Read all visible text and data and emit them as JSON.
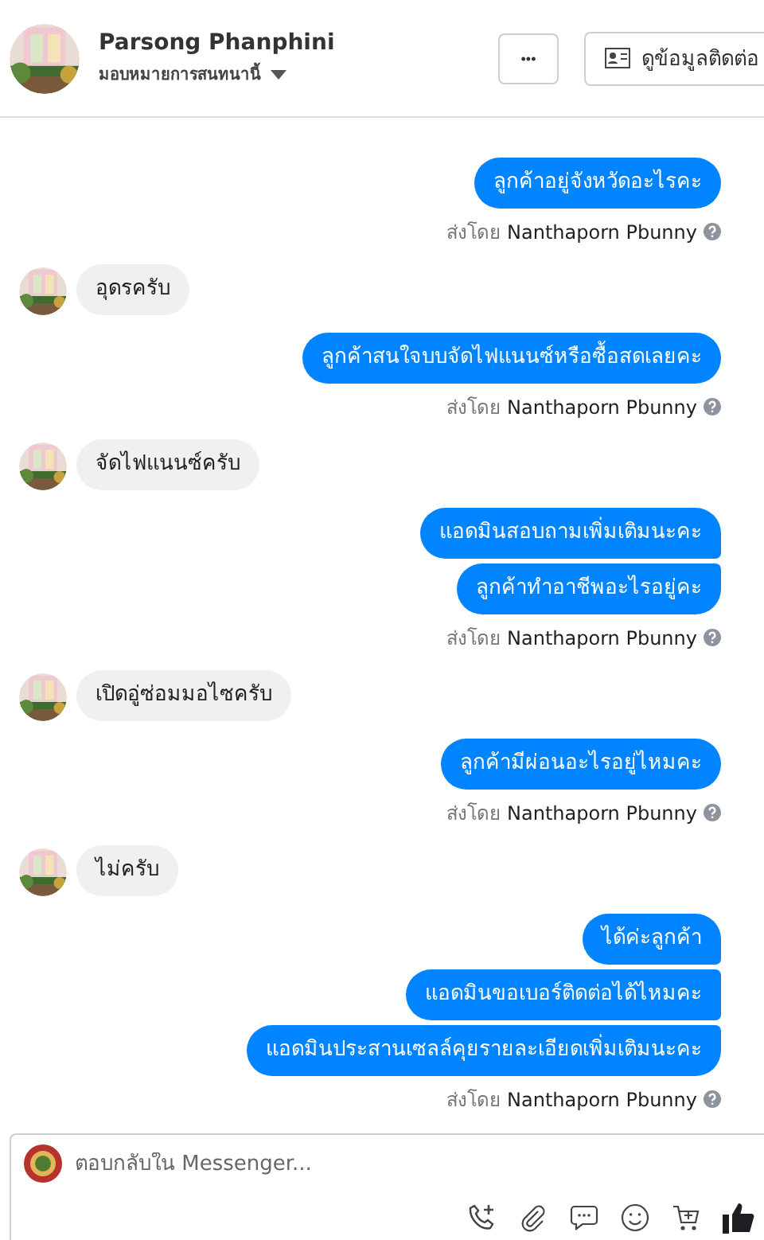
{
  "header": {
    "name": "Parsong Phanphini",
    "subtitle": "มอบหมายการสนทนานี้",
    "more_button": "•••",
    "contact_button": "ดูข้อมูลติดต่อ"
  },
  "messages": [
    {
      "kind": "outgoing",
      "bubbles": [
        "ลูกค้าอยู่จังหวัดอะไรคะ"
      ],
      "sent_prefix": "ส่งโดย",
      "sent_by": "Nanthaporn Pbunny"
    },
    {
      "kind": "incoming",
      "bubbles": [
        "อุดรครับ"
      ]
    },
    {
      "kind": "outgoing",
      "bubbles": [
        "ลูกค้าสนใจบบจัดไฟแนนซ์หรือซื้อสดเลยคะ"
      ],
      "sent_prefix": "ส่งโดย",
      "sent_by": "Nanthaporn Pbunny"
    },
    {
      "kind": "incoming",
      "bubbles": [
        "จัดไฟแนนซ์ครับ"
      ]
    },
    {
      "kind": "outgoing",
      "bubbles": [
        "แอดมินสอบถามเพิ่มเติมนะคะ",
        "ลูกค้าทำอาชีพอะไรอยู่คะ"
      ],
      "sent_prefix": "ส่งโดย",
      "sent_by": "Nanthaporn Pbunny"
    },
    {
      "kind": "incoming",
      "bubbles": [
        "เปิดอู่ซ่อมมอไซครับ"
      ]
    },
    {
      "kind": "outgoing",
      "bubbles": [
        "ลูกค้ามีผ่อนอะไรอยู่ไหมคะ"
      ],
      "sent_prefix": "ส่งโดย",
      "sent_by": "Nanthaporn Pbunny"
    },
    {
      "kind": "incoming",
      "bubbles": [
        "ไม่ครับ"
      ]
    },
    {
      "kind": "outgoing",
      "bubbles": [
        "ได้ค่ะลูกค้า",
        "แอดมินขอเบอร์ติดต่อได้ไหมคะ",
        "แอดมินประสานเซลล์คุยรายละเอียดเพิ่มเติมนะคะ"
      ],
      "sent_prefix": "ส่งโดย",
      "sent_by": "Nanthaporn Pbunny"
    }
  ],
  "composer": {
    "placeholder": "ตอบกลับใน Messenger..."
  }
}
